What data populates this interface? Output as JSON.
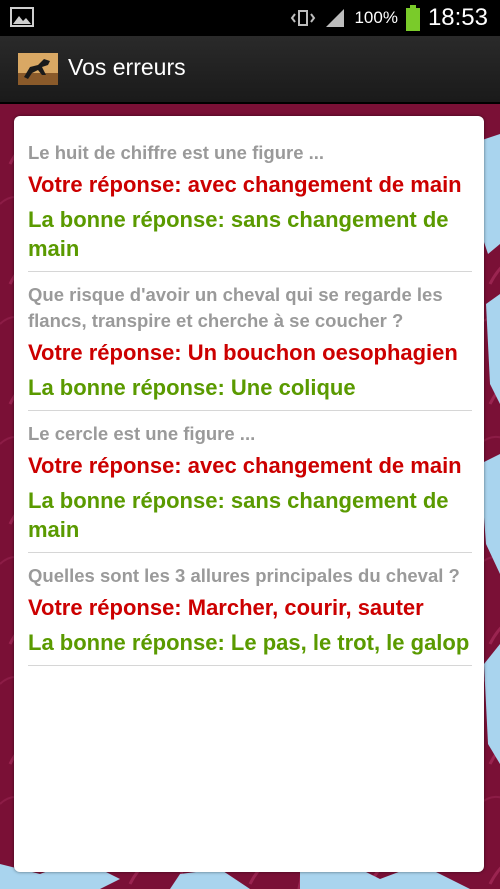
{
  "status_bar": {
    "battery_percent": "100%",
    "time": "18:53",
    "icons": [
      "image-icon",
      "vibrate-icon",
      "signal-icon",
      "battery-icon"
    ]
  },
  "action_bar": {
    "title": "Vos erreurs",
    "icon": "horse-app-icon"
  },
  "colors": {
    "background": "#7a1036",
    "question": "#9a9a9a",
    "wrong_answer": "#cc0000",
    "right_answer": "#5a9a00"
  },
  "errors": [
    {
      "question": "Le huit de chiffre est une figure ...",
      "your_answer": "Votre réponse: avec changement de main",
      "correct_answer": "La bonne réponse: sans changement de main"
    },
    {
      "question": "Que risque d'avoir un cheval qui se regarde les flancs, transpire et cherche à se coucher ?",
      "your_answer": "Votre réponse: Un bouchon oesophagien",
      "correct_answer": "La bonne réponse: Une colique"
    },
    {
      "question": "Le cercle est une figure ...",
      "your_answer": "Votre réponse: avec changement de main",
      "correct_answer": "La bonne réponse: sans changement de main"
    },
    {
      "question": "Quelles sont les 3 allures principales du cheval ?",
      "your_answer": "Votre réponse: Marcher, courir, sauter",
      "correct_answer": "La bonne réponse: Le pas, le trot, le galop"
    }
  ]
}
